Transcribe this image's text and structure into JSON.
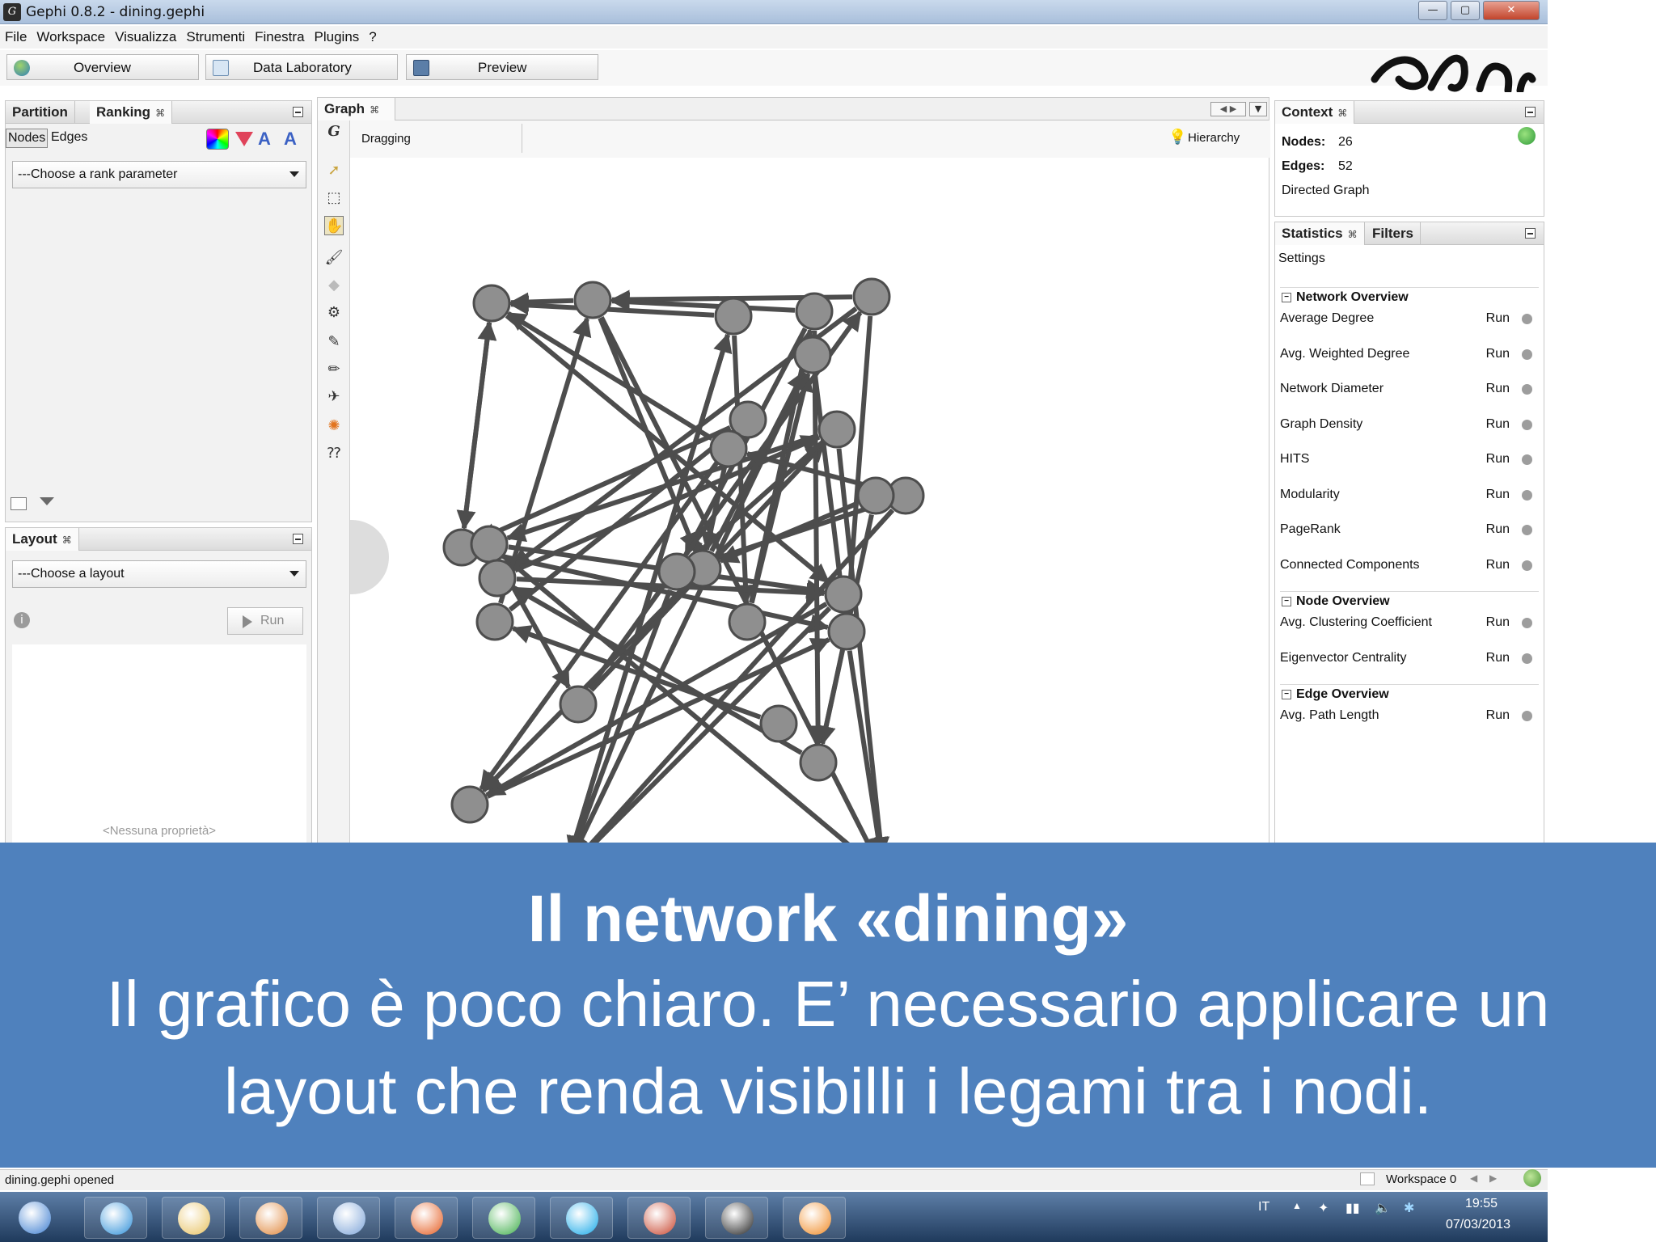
{
  "window": {
    "title": "Gephi 0.8.2 - dining.gephi",
    "controls": [
      "—",
      "▢",
      "✕"
    ]
  },
  "menu": [
    "File",
    "Workspace",
    "Visualizza",
    "Strumenti",
    "Finestra",
    "Plugins",
    "?"
  ],
  "modes": {
    "overview": "Overview",
    "data_lab": "Data Laboratory",
    "preview": "Preview"
  },
  "ranking": {
    "tabs": [
      "Partition",
      "Ranking"
    ],
    "subtabs": [
      "Nodes",
      "Edges"
    ],
    "dropdown": "---Choose a rank parameter"
  },
  "layout": {
    "tab": "Layout",
    "dropdown": "---Choose a layout",
    "run_label": "Run",
    "empty_note": "<Nessuna proprietà>"
  },
  "graph": {
    "tab": "Graph",
    "mode_label": "Dragging",
    "hierarchy_label": "Hierarchy",
    "node_color": "#8f8f8f",
    "edge_color": "#4d4d4d"
  },
  "context": {
    "tab": "Context",
    "nodes_label": "Nodes:",
    "nodes_value": "26",
    "edges_label": "Edges:",
    "edges_value": "52",
    "graph_type": "Directed Graph"
  },
  "statistics": {
    "tabs": [
      "Statistics",
      "Filters"
    ],
    "settings_label": "Settings",
    "run_label": "Run",
    "sections": [
      {
        "title": "Network Overview",
        "items": [
          "Average Degree",
          "Avg. Weighted Degree",
          "Network Diameter",
          "Graph Density",
          "HITS",
          "Modularity",
          "PageRank",
          "Connected Components"
        ]
      },
      {
        "title": "Node Overview",
        "items": [
          "Avg. Clustering Coefficient",
          "Eigenvector Centrality"
        ]
      },
      {
        "title": "Edge Overview",
        "items": [
          "Avg. Path Length"
        ]
      }
    ]
  },
  "caption": {
    "title": "Il network  «dining»",
    "line1": "Il grafico è poco chiaro. E’ necessario applicare un",
    "line2": "layout che renda visibilli i legami tra i nodi.",
    "background": "#4f81bd"
  },
  "status": {
    "message": "dining.gephi opened",
    "workspace": "Workspace 0"
  },
  "taskbar": {
    "lang": "IT",
    "time": "19:55",
    "date": "07/03/2013",
    "apps": [
      "start-orb-icon",
      "internet-explorer-icon",
      "file-explorer-icon",
      "media-player-icon",
      "tool-icon",
      "firefox-icon",
      "chrome-icon",
      "skype-icon",
      "powerpoint-icon",
      "gephi-icon",
      "vlc-icon"
    ]
  }
}
